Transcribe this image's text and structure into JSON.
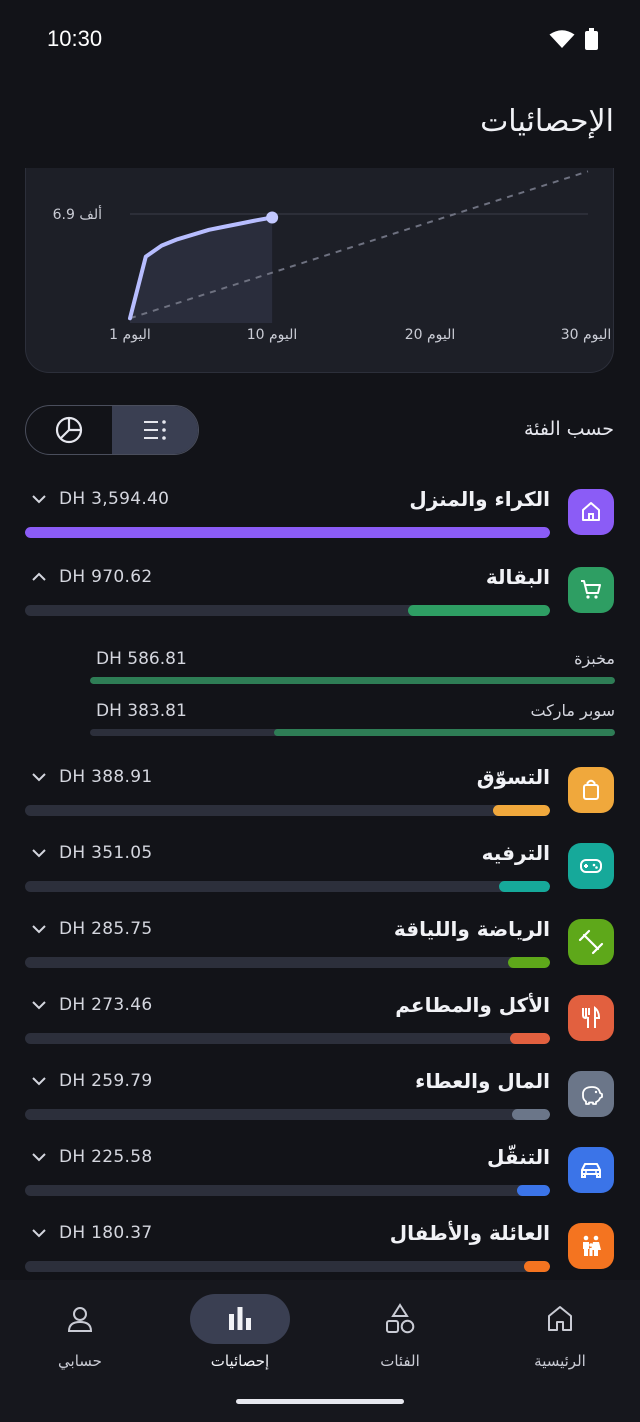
{
  "status": {
    "time": "10:30"
  },
  "title": "الإحصائيات",
  "chart": {
    "y_tick": "6.9 ألف",
    "x_ticks": [
      "اليوم 1",
      "اليوم 10",
      "اليوم 20",
      "اليوم 30"
    ]
  },
  "chart_data": {
    "type": "line",
    "ylabel_tick": "6.9 ألف",
    "x_ticks": [
      "اليوم 1",
      "اليوم 10",
      "اليوم 20",
      "اليوم 30"
    ],
    "series": [
      {
        "x": [
          1,
          2,
          3,
          4,
          5,
          6,
          7,
          8,
          9,
          10
        ],
        "values": [
          0.3,
          4.2,
          4.9,
          5.3,
          5.6,
          5.9,
          6.1,
          6.3,
          6.5,
          6.68
        ]
      }
    ],
    "trend": {
      "x": [
        1,
        30
      ],
      "values": [
        0.3,
        9.6
      ]
    }
  },
  "section_label": "حسب الفئة",
  "toggle": {
    "pie_icon": "pie-chart-icon",
    "list_icon": "list-icon",
    "active": "list"
  },
  "categories": [
    {
      "name": "الكراء والمنزل",
      "amount": "DH 3,594.40",
      "icon": "home-icon",
      "color": "#8b5cf6",
      "fraction": 1.0,
      "expanded": false
    },
    {
      "name": "البقالة",
      "amount": "DH 970.62",
      "icon": "cart-icon",
      "color": "#2e9e63",
      "fraction": 0.27,
      "expanded": true,
      "subs": [
        {
          "name": "مخبزة",
          "amount": "DH 586.81",
          "fraction": 1.0
        },
        {
          "name": "سوبر ماركت",
          "amount": "DH 383.81",
          "fraction": 0.65
        }
      ]
    },
    {
      "name": "التسوّق",
      "amount": "DH 388.91",
      "icon": "bag-icon",
      "color": "#f0a83c",
      "fraction": 0.108,
      "expanded": false
    },
    {
      "name": "الترفيه",
      "amount": "DH 351.05",
      "icon": "gamepad-icon",
      "color": "#16a99a",
      "fraction": 0.098,
      "expanded": false
    },
    {
      "name": "الرياضة واللياقة",
      "amount": "DH 285.75",
      "icon": "dumbbell-icon",
      "color": "#5ea81a",
      "fraction": 0.08,
      "expanded": false
    },
    {
      "name": "الأكل والمطاعم",
      "amount": "DH 273.46",
      "icon": "utensils-icon",
      "color": "#e2603f",
      "fraction": 0.076,
      "expanded": false
    },
    {
      "name": "المال والعطاء",
      "amount": "DH 259.79",
      "icon": "piggy-bank-icon",
      "color": "#6b7689",
      "fraction": 0.072,
      "expanded": false
    },
    {
      "name": "التنقّل",
      "amount": "DH 225.58",
      "icon": "car-icon",
      "color": "#3b74e8",
      "fraction": 0.063,
      "expanded": false
    },
    {
      "name": "العائلة والأطفال",
      "amount": "DH 180.37",
      "icon": "family-icon",
      "color": "#f47420",
      "fraction": 0.05,
      "expanded": false
    }
  ],
  "nav": [
    {
      "label": "حسابي",
      "icon": "user-icon",
      "active": false
    },
    {
      "label": "إحصائيات",
      "icon": "bar-chart-icon",
      "active": true
    },
    {
      "label": "الفئات",
      "icon": "shapes-icon",
      "active": false
    },
    {
      "label": "الرئيسية",
      "icon": "home-icon",
      "active": false
    }
  ]
}
